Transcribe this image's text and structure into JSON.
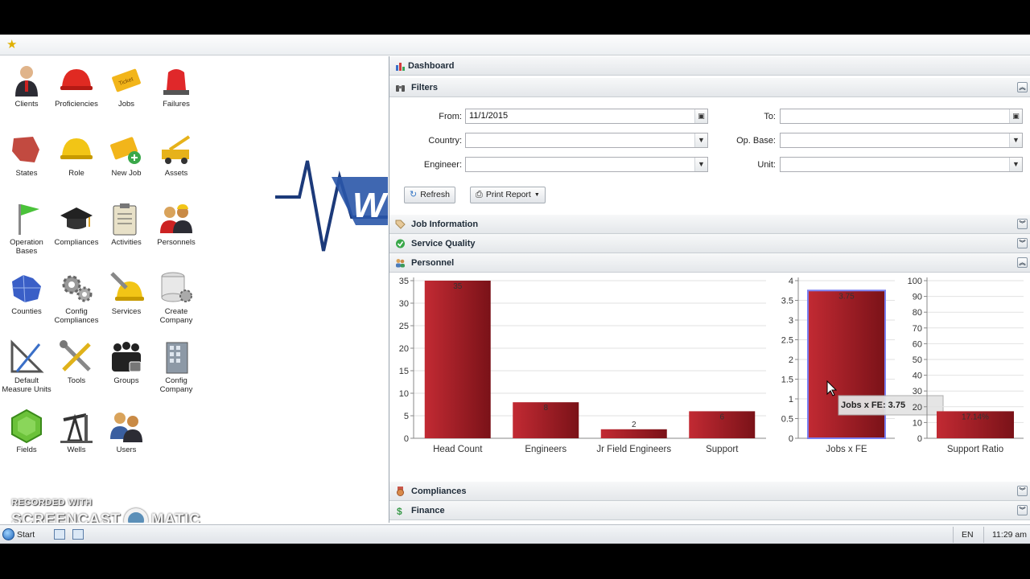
{
  "desktop_icons": [
    {
      "label": "Clients",
      "icon": "person-icon"
    },
    {
      "label": "Proficiencies",
      "icon": "red-hardhat-icon"
    },
    {
      "label": "Jobs",
      "icon": "ticket-icon"
    },
    {
      "label": "Failures",
      "icon": "alarm-light-icon"
    },
    {
      "label": "States",
      "icon": "state-map-icon"
    },
    {
      "label": "Role",
      "icon": "yellow-hardhat-icon"
    },
    {
      "label": "New Job",
      "icon": "ticket-add-icon"
    },
    {
      "label": "Assets",
      "icon": "crane-truck-icon"
    },
    {
      "label": "Operation Bases",
      "icon": "flag-icon"
    },
    {
      "label": "Compliances",
      "icon": "graduation-cap-icon"
    },
    {
      "label": "Activities",
      "icon": "clipboard-icon"
    },
    {
      "label": "Personnels",
      "icon": "workers-icon"
    },
    {
      "label": "Counties",
      "icon": "county-map-icon"
    },
    {
      "label": "Config Compliances",
      "icon": "gears-icon"
    },
    {
      "label": "Services",
      "icon": "hardhat-wrench-icon"
    },
    {
      "label": "Create Company",
      "icon": "database-gear-icon"
    },
    {
      "label": "Default Measure Units",
      "icon": "drafting-tools-icon"
    },
    {
      "label": "Tools",
      "icon": "tools-icon"
    },
    {
      "label": "Groups",
      "icon": "group-lock-icon"
    },
    {
      "label": "Config Company",
      "icon": "building-icon"
    },
    {
      "label": "Fields",
      "icon": "hexagon-icon"
    },
    {
      "label": "Wells",
      "icon": "pumpjack-icon"
    },
    {
      "label": "Users",
      "icon": "users-icon"
    }
  ],
  "logo": {
    "letter": "W"
  },
  "watermark": {
    "line1": "RECORDED WITH",
    "line2a": "SCREENCAST",
    "line2b": "MATIC"
  },
  "taskbar": {
    "start_label": "Start",
    "lang": "EN",
    "clock": "11:29 am"
  },
  "dashboard": {
    "title": "Dashboard",
    "filters": {
      "title": "Filters",
      "from_label": "From:",
      "from_value": "11/1/2015",
      "to_label": "To:",
      "to_value": "",
      "country_label": "Country:",
      "country_value": "",
      "opbase_label": "Op. Base:",
      "opbase_value": "",
      "engineer_label": "Engineer:",
      "engineer_value": "",
      "unit_label": "Unit:",
      "unit_value": "",
      "refresh_label": "Refresh",
      "print_label": "Print Report"
    },
    "sections": {
      "job_information": "Job Information",
      "service_quality": "Service Quality",
      "personnel": "Personnel",
      "compliances": "Compliances",
      "finance": "Finance"
    },
    "colors": {
      "bar_dark": "#7a1218",
      "bar_light": "#c22a33",
      "highlight": "#7a7ff0"
    }
  },
  "chart_data": [
    {
      "type": "bar",
      "categories": [
        "Head Count",
        "Engineers",
        "Jr Field Engineers",
        "Support"
      ],
      "values": [
        35,
        8,
        2,
        6
      ],
      "value_labels": [
        "35",
        "8",
        "2",
        "6"
      ],
      "ylim": [
        0,
        35
      ],
      "yticks": [
        0,
        5,
        10,
        15,
        20,
        25,
        30,
        35
      ],
      "grid": true
    },
    {
      "type": "bar",
      "categories": [
        "Jobs x FE"
      ],
      "values": [
        3.75
      ],
      "value_labels": [
        "3.75"
      ],
      "ylim": [
        0,
        4
      ],
      "yticks": [
        0,
        0.5,
        1,
        1.5,
        2,
        2.5,
        3,
        3.5,
        4
      ],
      "grid": true,
      "tooltip": "Jobs x FE: 3.75"
    },
    {
      "type": "bar",
      "categories": [
        "Support Ratio"
      ],
      "values": [
        17.14
      ],
      "value_labels": [
        "17.14%"
      ],
      "ylim": [
        0,
        100
      ],
      "yticks": [
        0,
        10,
        20,
        30,
        40,
        50,
        60,
        70,
        80,
        90,
        100
      ],
      "grid": true
    }
  ]
}
